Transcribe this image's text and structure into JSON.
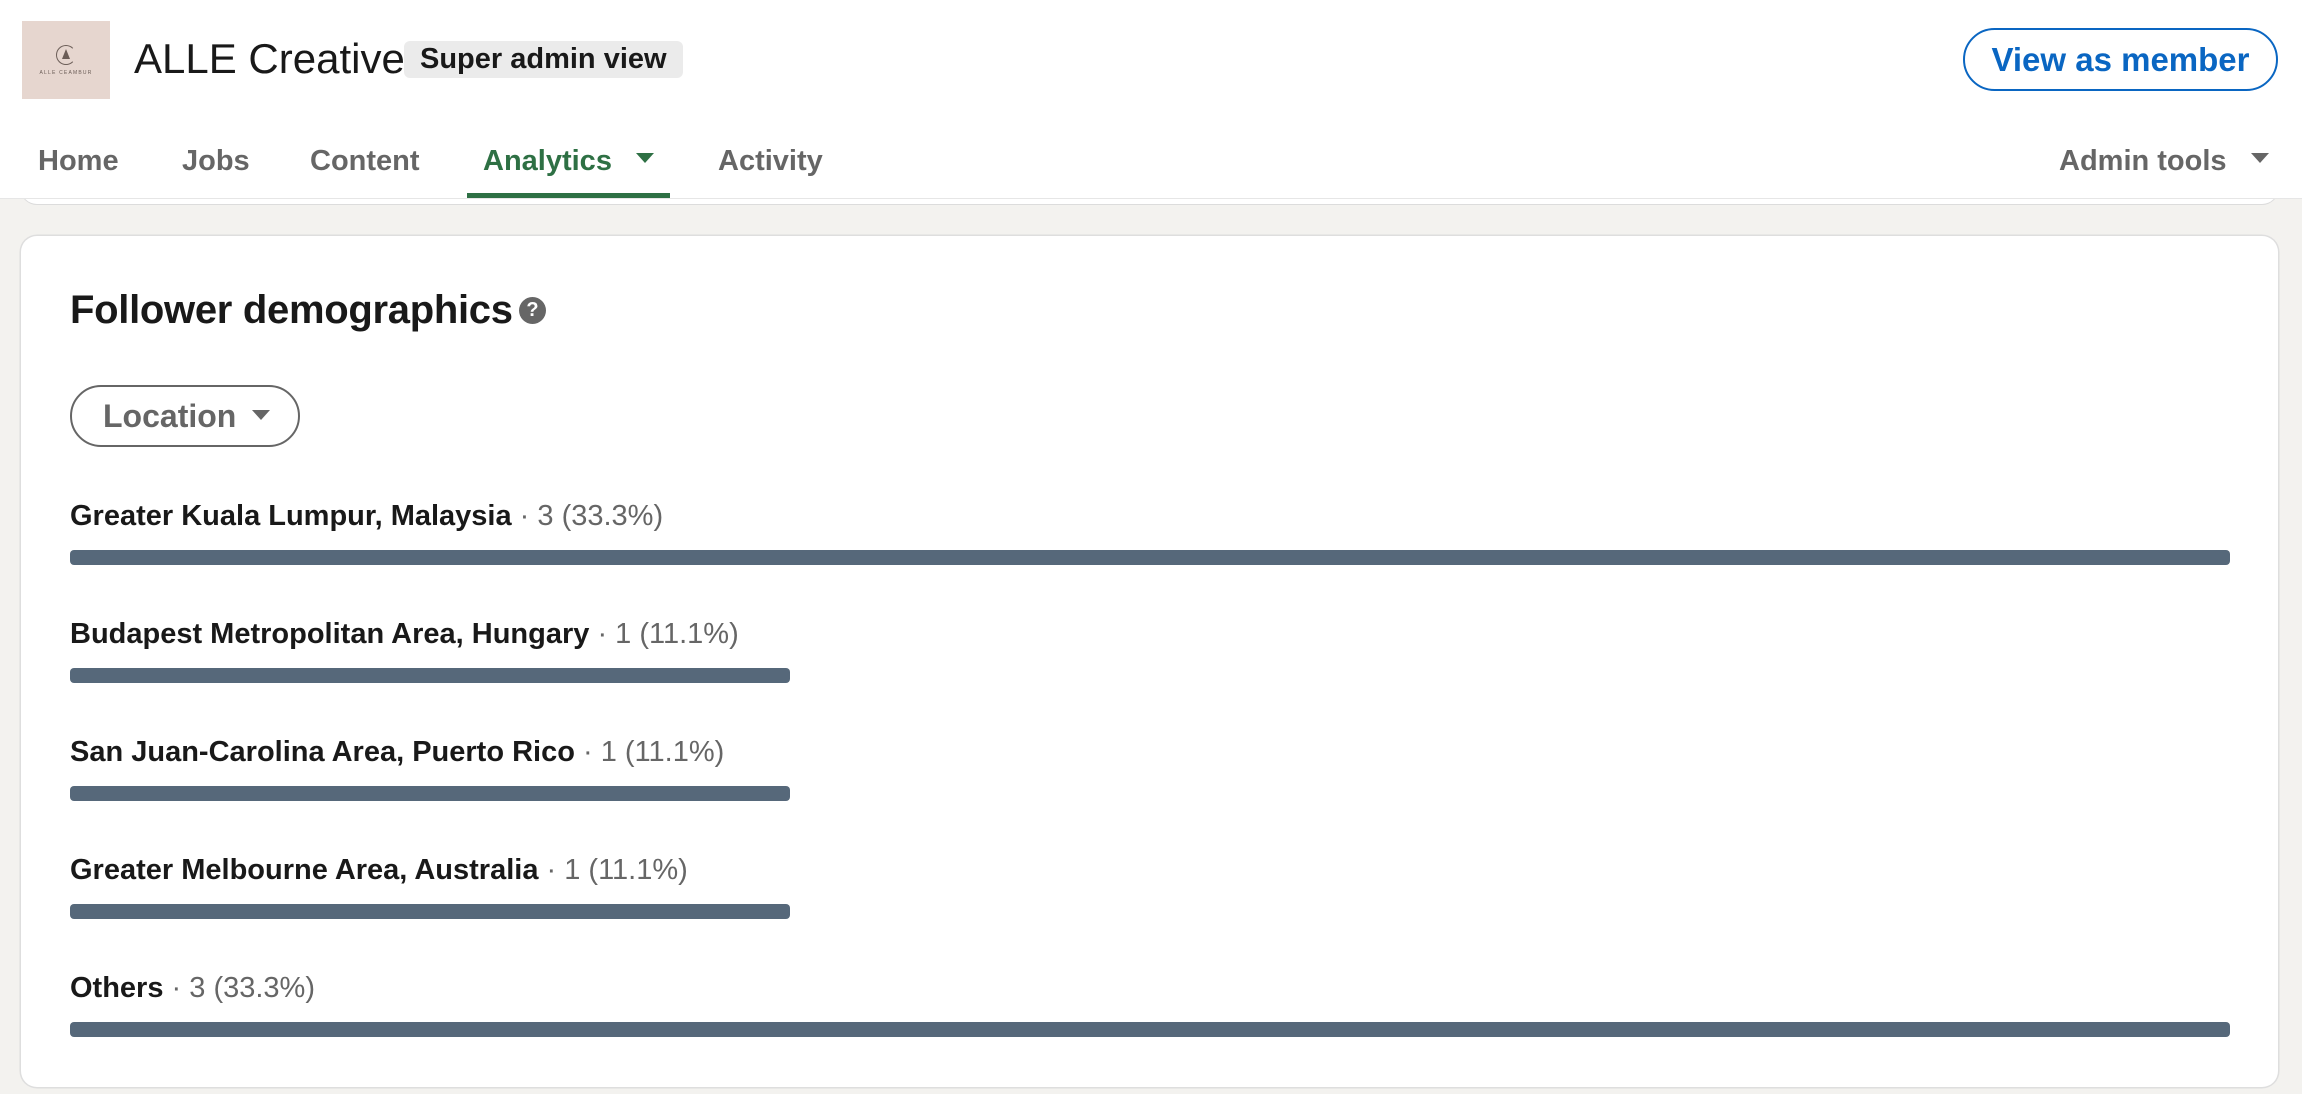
{
  "header": {
    "logo_text": "ALLE CEAMBUR",
    "company_name": "ALLE Creative",
    "badge": "Super admin view",
    "view_as_member": "View as member"
  },
  "nav": {
    "items": [
      {
        "label": "Home",
        "active": false
      },
      {
        "label": "Jobs",
        "active": false
      },
      {
        "label": "Content",
        "active": false
      },
      {
        "label": "Analytics",
        "active": true,
        "has_dropdown": true
      },
      {
        "label": "Activity",
        "active": false
      }
    ],
    "admin_tools": "Admin tools"
  },
  "card": {
    "title": "Follower demographics",
    "help_icon": "question-circle-icon",
    "help_glyph": "?",
    "filter": {
      "selected": "Location"
    },
    "separator": " · "
  },
  "colors": {
    "accent_green": "#2e7044",
    "link_blue": "#0a66c2",
    "bar": "#56687a"
  },
  "chart_data": {
    "type": "bar",
    "orientation": "horizontal",
    "title": "Follower demographics",
    "dimension": "Location",
    "categories": [
      "Greater Kuala Lumpur, Malaysia",
      "Budapest Metropolitan Area, Hungary",
      "San Juan-Carolina Area, Puerto Rico",
      "Greater Melbourne Area, Australia",
      "Others"
    ],
    "values": [
      3,
      1,
      1,
      1,
      3
    ],
    "percentages": [
      "33.3%",
      "11.1%",
      "11.1%",
      "11.1%",
      "33.3%"
    ],
    "labels": [
      "3 (33.3%)",
      "1 (11.1%)",
      "1 (11.1%)",
      "1 (11.1%)",
      "3 (33.3%)"
    ],
    "xlim": [
      0,
      3
    ]
  }
}
